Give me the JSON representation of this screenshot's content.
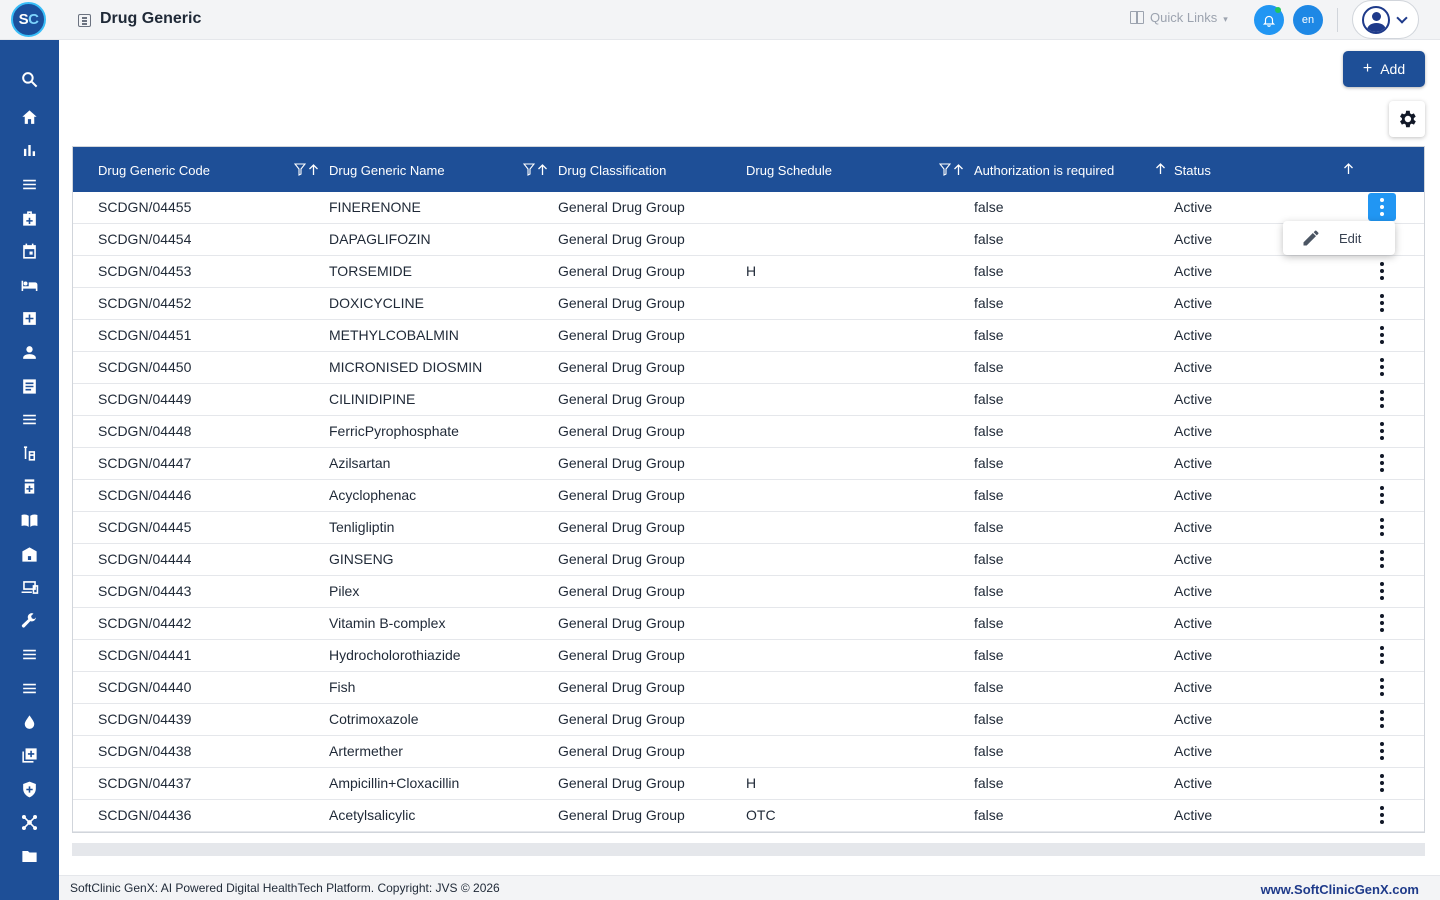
{
  "app": {
    "logo_text": "SC",
    "page_title": "Drug Generic"
  },
  "header": {
    "quick_links": "Quick Links",
    "language": "en"
  },
  "sidebar": {
    "items": [
      "search-icon",
      "home-icon",
      "chart-icon",
      "menu-icon",
      "medical-bag-icon",
      "calendar-icon",
      "bed-icon",
      "hospital-icon",
      "person-icon",
      "document-icon",
      "list-icon",
      "lab-icon",
      "pharmacy-icon",
      "book-icon",
      "building-icon",
      "devices-icon",
      "wrench-icon",
      "lines-icon",
      "lines2-icon",
      "blood-drop-icon",
      "add-box-icon",
      "shield-icon",
      "network-icon",
      "folder-icon"
    ]
  },
  "toolbar": {
    "add_label": "Add"
  },
  "table": {
    "columns": [
      "Drug Generic Code",
      "Drug Generic Name",
      "Drug Classification",
      "Drug Schedule",
      "Authorization is required",
      "Status"
    ],
    "rows": [
      [
        "SCDGN/04455",
        "FINERENONE",
        "General Drug Group",
        "",
        "false",
        "Active"
      ],
      [
        "SCDGN/04454",
        "DAPAGLIFOZIN",
        "General Drug Group",
        "",
        "false",
        "Active"
      ],
      [
        "SCDGN/04453",
        "TORSEMIDE",
        "General Drug Group",
        "H",
        "false",
        "Active"
      ],
      [
        "SCDGN/04452",
        "DOXICYCLINE",
        "General Drug Group",
        "",
        "false",
        "Active"
      ],
      [
        "SCDGN/04451",
        "METHYLCOBALMIN",
        "General Drug Group",
        "",
        "false",
        "Active"
      ],
      [
        "SCDGN/04450",
        "MICRONISED DIOSMIN",
        "General Drug Group",
        "",
        "false",
        "Active"
      ],
      [
        "SCDGN/04449",
        "CILINIDIPINE",
        "General Drug Group",
        "",
        "false",
        "Active"
      ],
      [
        "SCDGN/04448",
        "FerricPyrophosphate",
        "General Drug Group",
        "",
        "false",
        "Active"
      ],
      [
        "SCDGN/04447",
        "Azilsartan",
        "General Drug Group",
        "",
        "false",
        "Active"
      ],
      [
        "SCDGN/04446",
        "Acyclophenac",
        "General Drug Group",
        "",
        "false",
        "Active"
      ],
      [
        "SCDGN/04445",
        "Tenligliptin",
        "General Drug Group",
        "",
        "false",
        "Active"
      ],
      [
        "SCDGN/04444",
        "GINSENG",
        "General Drug Group",
        "",
        "false",
        "Active"
      ],
      [
        "SCDGN/04443",
        "Pilex",
        "General Drug Group",
        "",
        "false",
        "Active"
      ],
      [
        "SCDGN/04442",
        "Vitamin B-complex",
        "General Drug Group",
        "",
        "false",
        "Active"
      ],
      [
        "SCDGN/04441",
        "Hydrocholorothiazide",
        "General Drug Group",
        "",
        "false",
        "Active"
      ],
      [
        "SCDGN/04440",
        "Fish",
        "General Drug Group",
        "",
        "false",
        "Active"
      ],
      [
        "SCDGN/04439",
        "Cotrimoxazole",
        "General Drug Group",
        "",
        "false",
        "Active"
      ],
      [
        "SCDGN/04438",
        "Artermether",
        "General Drug Group",
        "",
        "false",
        "Active"
      ],
      [
        "SCDGN/04437",
        "Ampicillin+Cloxacillin",
        "General Drug Group",
        "H",
        "false",
        "Active"
      ],
      [
        "SCDGN/04436",
        "Acetylsalicylic",
        "General Drug Group",
        "OTC",
        "false",
        "Active"
      ]
    ]
  },
  "context_menu": {
    "edit_label": "Edit"
  },
  "footer": {
    "copyright": "SoftClinic GenX: AI Powered Digital HealthTech Platform. Copyright: JVS © 2026",
    "website": "www.SoftClinicGenX.com"
  },
  "colors": {
    "primary": "#1e4f97",
    "accent": "#2196f3",
    "status_dot": "#22c55e"
  }
}
